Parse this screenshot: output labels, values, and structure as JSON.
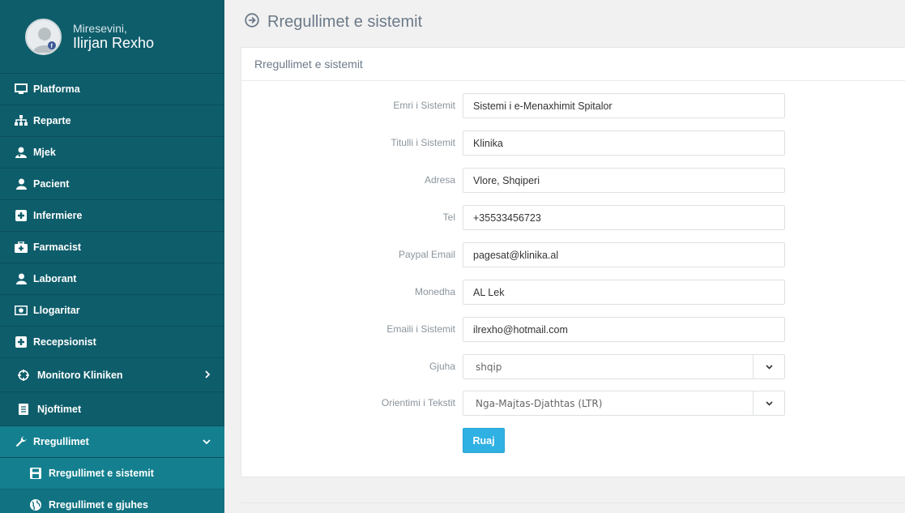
{
  "user": {
    "greeting": "Miresevini,",
    "name": "Ilirjan Rexho"
  },
  "sidebar": {
    "items": [
      {
        "label": "Platforma",
        "icon": "monitor-icon"
      },
      {
        "label": "Reparte",
        "icon": "sitemap-icon"
      },
      {
        "label": "Mjek",
        "icon": "user-md-icon"
      },
      {
        "label": "Pacient",
        "icon": "user-icon"
      },
      {
        "label": "Infermiere",
        "icon": "plus-square-icon"
      },
      {
        "label": "Farmacist",
        "icon": "medkit-icon"
      },
      {
        "label": "Laborant",
        "icon": "user-icon"
      },
      {
        "label": "Llogaritar",
        "icon": "money-icon"
      },
      {
        "label": "Recepsionist",
        "icon": "plus-square-icon"
      },
      {
        "label": "Monitoro Kliniken",
        "icon": "crosshair-icon"
      },
      {
        "label": "Njoftimet",
        "icon": "file-text-icon"
      },
      {
        "label": "Rregullimet",
        "icon": "wrench-icon"
      }
    ],
    "sub_items": [
      {
        "label": "Rregullimet e sistemit",
        "icon": "floppy-icon"
      },
      {
        "label": "Rregullimet e gjuhes",
        "icon": "globe-icon"
      }
    ]
  },
  "page": {
    "title": "Rregullimet e sistemit",
    "panel_title": "Rregullimet e sistemit"
  },
  "form": {
    "fields": [
      {
        "label": "Emri i Sistemit",
        "value": "Sistemi i e-Menaxhimit Spitalor"
      },
      {
        "label": "Titulli i Sistemit",
        "value": "Klinika"
      },
      {
        "label": "Adresa",
        "value": "Vlore, Shqiperi"
      },
      {
        "label": "Tel",
        "value": "+35533456723"
      },
      {
        "label": "Paypal Email",
        "value": "pagesat@klinika.al"
      },
      {
        "label": "Monedha",
        "value": "AL Lek"
      },
      {
        "label": "Emaili i Sistemit",
        "value": "ilrexho@hotmail.com"
      }
    ],
    "selects": [
      {
        "label": "Gjuha",
        "value": "shqip"
      },
      {
        "label": "Orientimi i Tekstit",
        "value": "Nga-Majtas-Djathtas (LTR)"
      }
    ],
    "save_label": "Ruaj"
  },
  "colors": {
    "sidebar_bg": "#0e5d6b",
    "sidebar_active": "#14808f",
    "accent_button": "#2fb1e3"
  }
}
